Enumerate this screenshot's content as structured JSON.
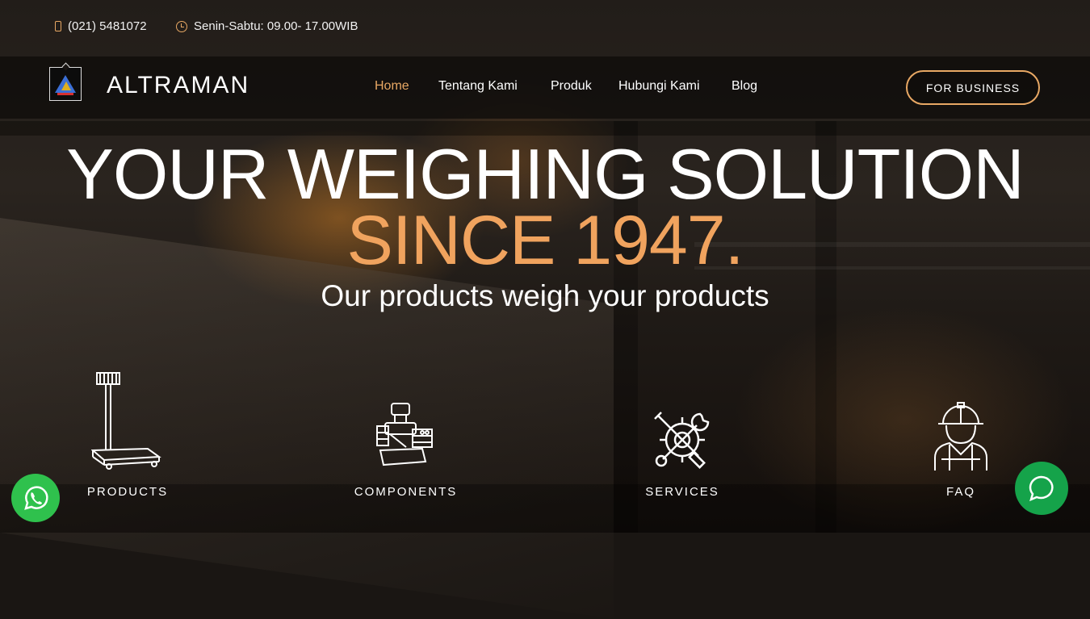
{
  "topbar": {
    "phone": "(021) 5481072",
    "hours": "Senin-Sabtu: 09.00- 17.00WIB"
  },
  "header": {
    "brand": "ALTRAMAN",
    "nav": [
      "Home",
      "Tentang Kami",
      "Produk",
      "Hubungi Kami",
      "Blog"
    ],
    "active_nav": "Home",
    "cta_label": "FOR BUSINESS"
  },
  "hero": {
    "title": "YOUR WEIGHING SOLUTION",
    "since": "SINCE 1947.",
    "subtitle": "Our products weigh your products"
  },
  "features": [
    {
      "label": "PRODUCTS",
      "icon": "platform-scale-icon"
    },
    {
      "label": "COMPONENTS",
      "icon": "load-cell-components-icon"
    },
    {
      "label": "SERVICES",
      "icon": "wrench-screwdriver-gear-icon"
    },
    {
      "label": "FAQ",
      "icon": "worker-helmet-icon"
    }
  ],
  "floating": {
    "whatsapp_icon": "whatsapp-icon",
    "chat_icon": "chat-bubble-icon"
  },
  "colors": {
    "accent": "#e8a864",
    "since": "#f0a35e",
    "whatsapp": "#2fc14d",
    "chat": "#15a34a"
  }
}
